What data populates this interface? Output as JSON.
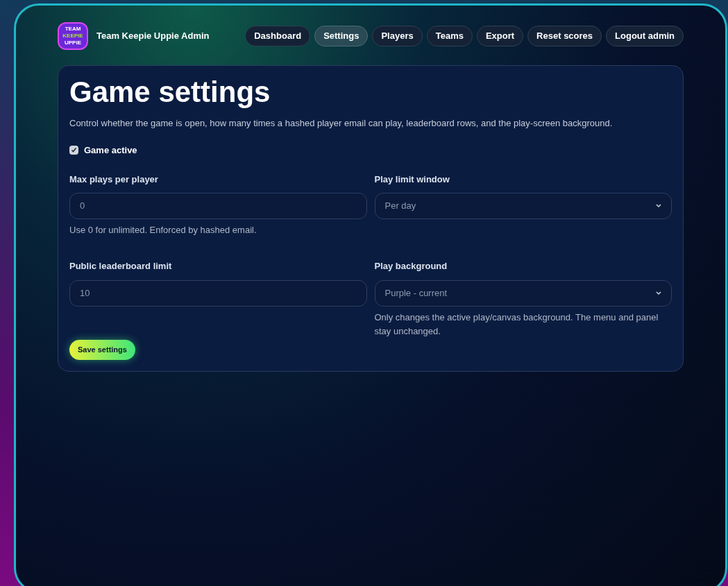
{
  "header": {
    "logo_lines": [
      "TEAM",
      "KEEPIE",
      "UPPIE"
    ],
    "title": "Team Keepie Uppie Admin",
    "nav": [
      {
        "label": "Dashboard",
        "selected": false
      },
      {
        "label": "Settings",
        "selected": true
      },
      {
        "label": "Players",
        "selected": false
      },
      {
        "label": "Teams",
        "selected": false
      },
      {
        "label": "Export",
        "selected": false
      },
      {
        "label": "Reset scores",
        "selected": false
      },
      {
        "label": "Logout admin",
        "selected": false
      }
    ]
  },
  "card": {
    "title": "Game settings",
    "description": "Control whether the game is open, how many times a hashed player email can play, leaderboard rows, and the play-screen background.",
    "game_active": {
      "label": "Game active",
      "checked": true
    },
    "fields": [
      {
        "kind": "input",
        "label": "Max plays per player",
        "value": "0",
        "help": "Use 0 for unlimited. Enforced by hashed email."
      },
      {
        "kind": "select",
        "label": "Play limit window",
        "value": "Per day"
      },
      {
        "kind": "input",
        "label": "Public leaderboard limit",
        "value": "10"
      },
      {
        "kind": "select",
        "label": "Play background",
        "value": "Purple - current",
        "help": "Only changes the active play/canvas background. The menu and panel stay unchanged."
      }
    ],
    "save_button": "Save settings"
  }
}
